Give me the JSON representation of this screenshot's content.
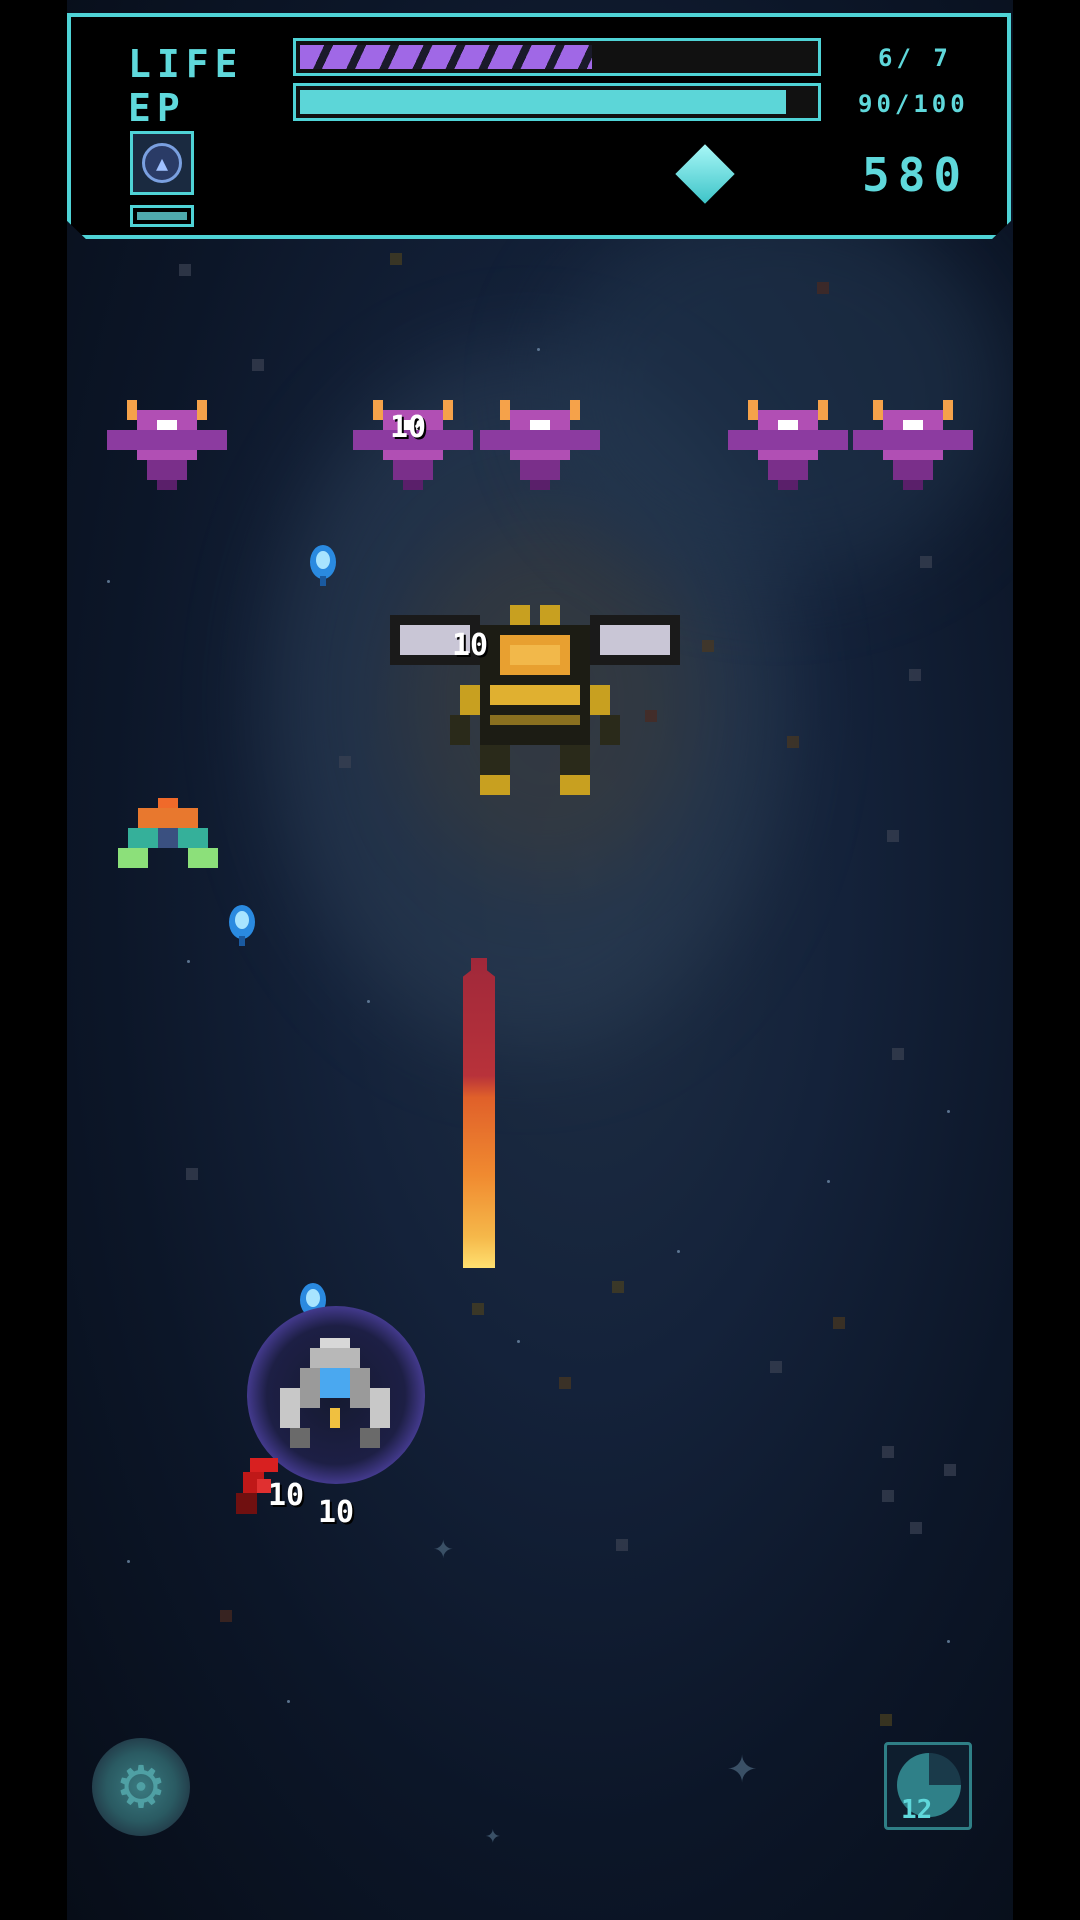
{
  "hud": {
    "life_label": "LIFE",
    "ep_label": "EP",
    "life_text": "6/ 7",
    "life_value": 6,
    "life_max": 7,
    "ep_text": "90/100",
    "ep_value": 90,
    "ep_max": 100,
    "score": "580",
    "accent_color": "#4fd3d6"
  },
  "damage_numbers": [
    "10",
    "10",
    "10",
    "10"
  ],
  "bomb_count": "12",
  "icons": {
    "skill": "shield-ring-icon",
    "currency": "diamond-gem-icon",
    "settings": "gear-icon",
    "bomb": "bomb-radar-icon"
  }
}
